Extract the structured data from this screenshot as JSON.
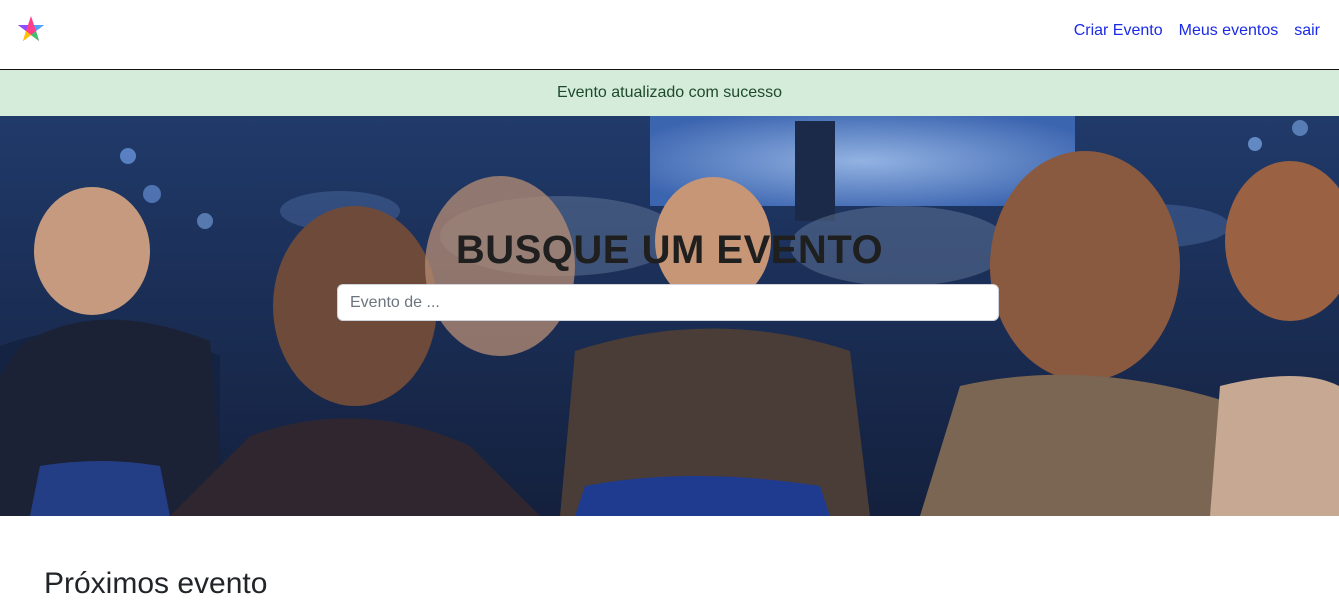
{
  "nav": {
    "logo_icon": "colorful-star-logo-icon",
    "links": [
      {
        "label": "Criar Evento"
      },
      {
        "label": "Meus eventos"
      },
      {
        "label": "sair"
      }
    ]
  },
  "alert": {
    "message": "Evento atualizado com sucesso",
    "bg_color": "#d5ecdb"
  },
  "hero": {
    "title": "BUSQUE UM EVENTO",
    "search_placeholder": "Evento de ...",
    "search_value": ""
  },
  "main": {
    "section_title": "Próximos evento"
  },
  "colors": {
    "link": "#1a2be6",
    "navbar_bg": "#ffffff"
  }
}
